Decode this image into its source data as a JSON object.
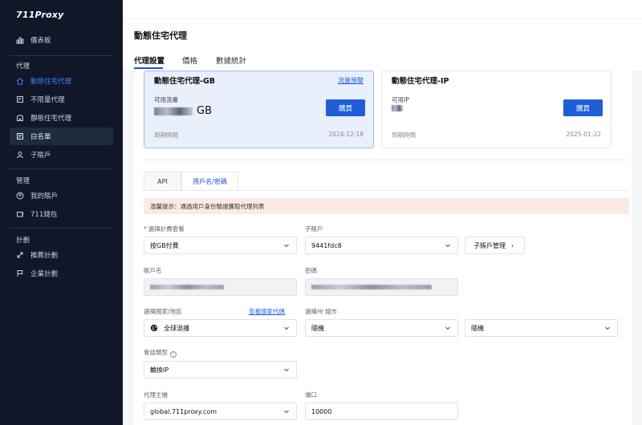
{
  "brand": {
    "logo": "711Proxy"
  },
  "sidebar": {
    "dashboard": "儀表板",
    "section_proxy": "代理",
    "proxy_items": [
      {
        "label": "動態住宅代理",
        "icon": "home-icon"
      },
      {
        "label": "不限量代理",
        "icon": "infinity-icon"
      },
      {
        "label": "靜態住宅代理",
        "icon": "building-icon"
      },
      {
        "label": "白名單",
        "icon": "list-icon"
      },
      {
        "label": "子賬戶",
        "icon": "user-icon"
      }
    ],
    "section_manage": "管理",
    "manage_items": [
      {
        "label": "我的賬戶",
        "icon": "account-icon"
      },
      {
        "label": "711錢包",
        "icon": "wallet-icon"
      }
    ],
    "section_plan": "計劃",
    "plan_items": [
      {
        "label": "推薦計劃",
        "icon": "referral-icon"
      },
      {
        "label": "企業計劃",
        "icon": "flag-icon"
      }
    ]
  },
  "page": {
    "title": "動態住宅代理",
    "tabs": [
      "代理設置",
      "價格",
      "數據統計"
    ]
  },
  "cards": [
    {
      "title": "動態住宅代理-GB",
      "link": "流量預警",
      "sub": "可用流量",
      "unit": "GB",
      "button": "購買",
      "expire_label": "到期時間",
      "expire_date": "2024-12-18"
    },
    {
      "title": "動態住宅代理-IP",
      "sub": "可用IP",
      "button": "購買",
      "expire_label": "到期時間",
      "expire_date": "2025-01-22"
    }
  ],
  "subtabs": [
    "API",
    "用戶名/密碼"
  ],
  "notice": "溫馨提示：通過用戶身份驗證獲取代理列表",
  "form": {
    "billing_label": "選擇計費套餐",
    "billing_value": "按GB付費",
    "subaccount_label": "子賬戶",
    "subaccount_value": "9441fdc8",
    "subaccount_button": "子賬戶管理",
    "account_label": "賬戶名",
    "password_label": "密碼",
    "country_label": "選擇國家/地區",
    "country_link": "查看國家代碼",
    "country_value": "全球混播",
    "state_label": "選擇州·城市",
    "state_value": "隨機",
    "city_value": "隨機",
    "session_label": "會話類型",
    "session_value": "輪換IP",
    "host_label": "代理主機",
    "host_value": "global.711proxy.com",
    "port_label": "端口",
    "port_value": "10000"
  }
}
